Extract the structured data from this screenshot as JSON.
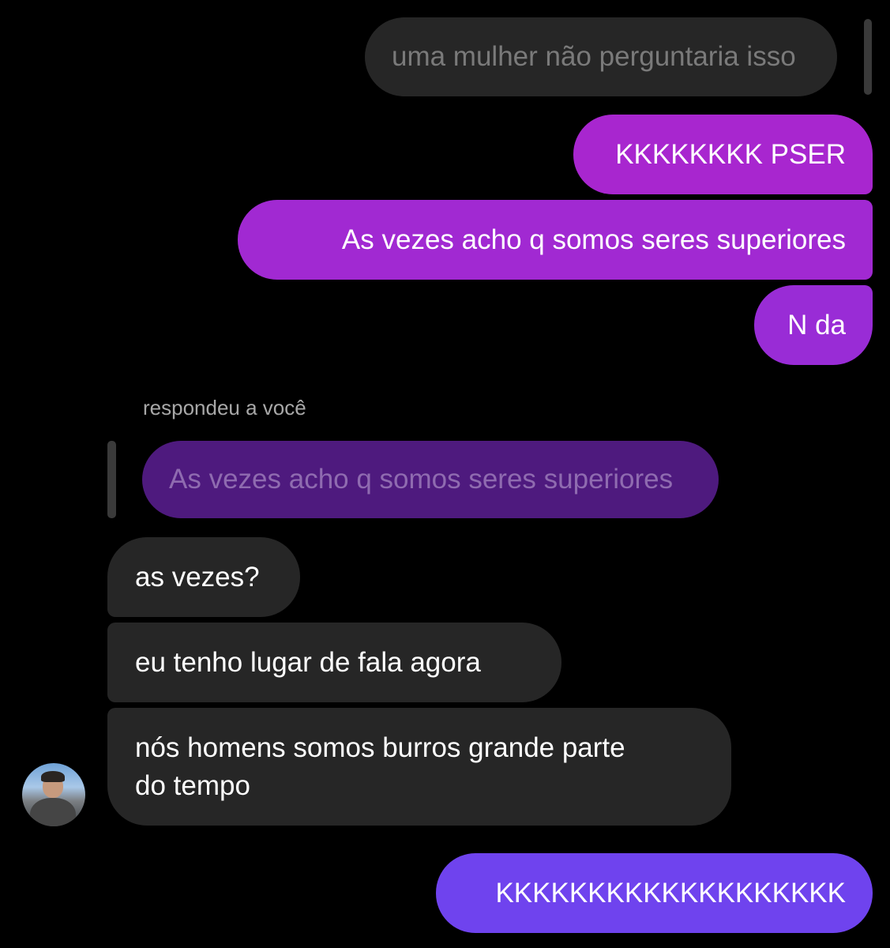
{
  "colors": {
    "background": "#000000",
    "incoming_bubble": "#262626",
    "outgoing_gradient_top": "#a826cf",
    "outgoing_gradient_bottom": "#6f43ee",
    "quoted_bubble": "#4e1a7e",
    "muted_text": "#7a7a7a"
  },
  "messages": {
    "reply_to_prev": "uma mulher não perguntaria isso",
    "out_1": "KKKKKKKK PSER",
    "out_2": "As vezes acho q somos seres superiores",
    "out_3": "N da",
    "reply_label": "respondeu a você",
    "quoted_text": "As vezes acho q somos seres superiores",
    "in_1": "as vezes?",
    "in_2": "eu tenho lugar de fala agora",
    "in_3_line1": "nós homens somos burros grande parte",
    "in_3_line2": "do tempo",
    "out_4": "KKKKKKKKKKKKKKKKKKK"
  },
  "icons": {
    "avatar": "profile-photo-avatar"
  }
}
